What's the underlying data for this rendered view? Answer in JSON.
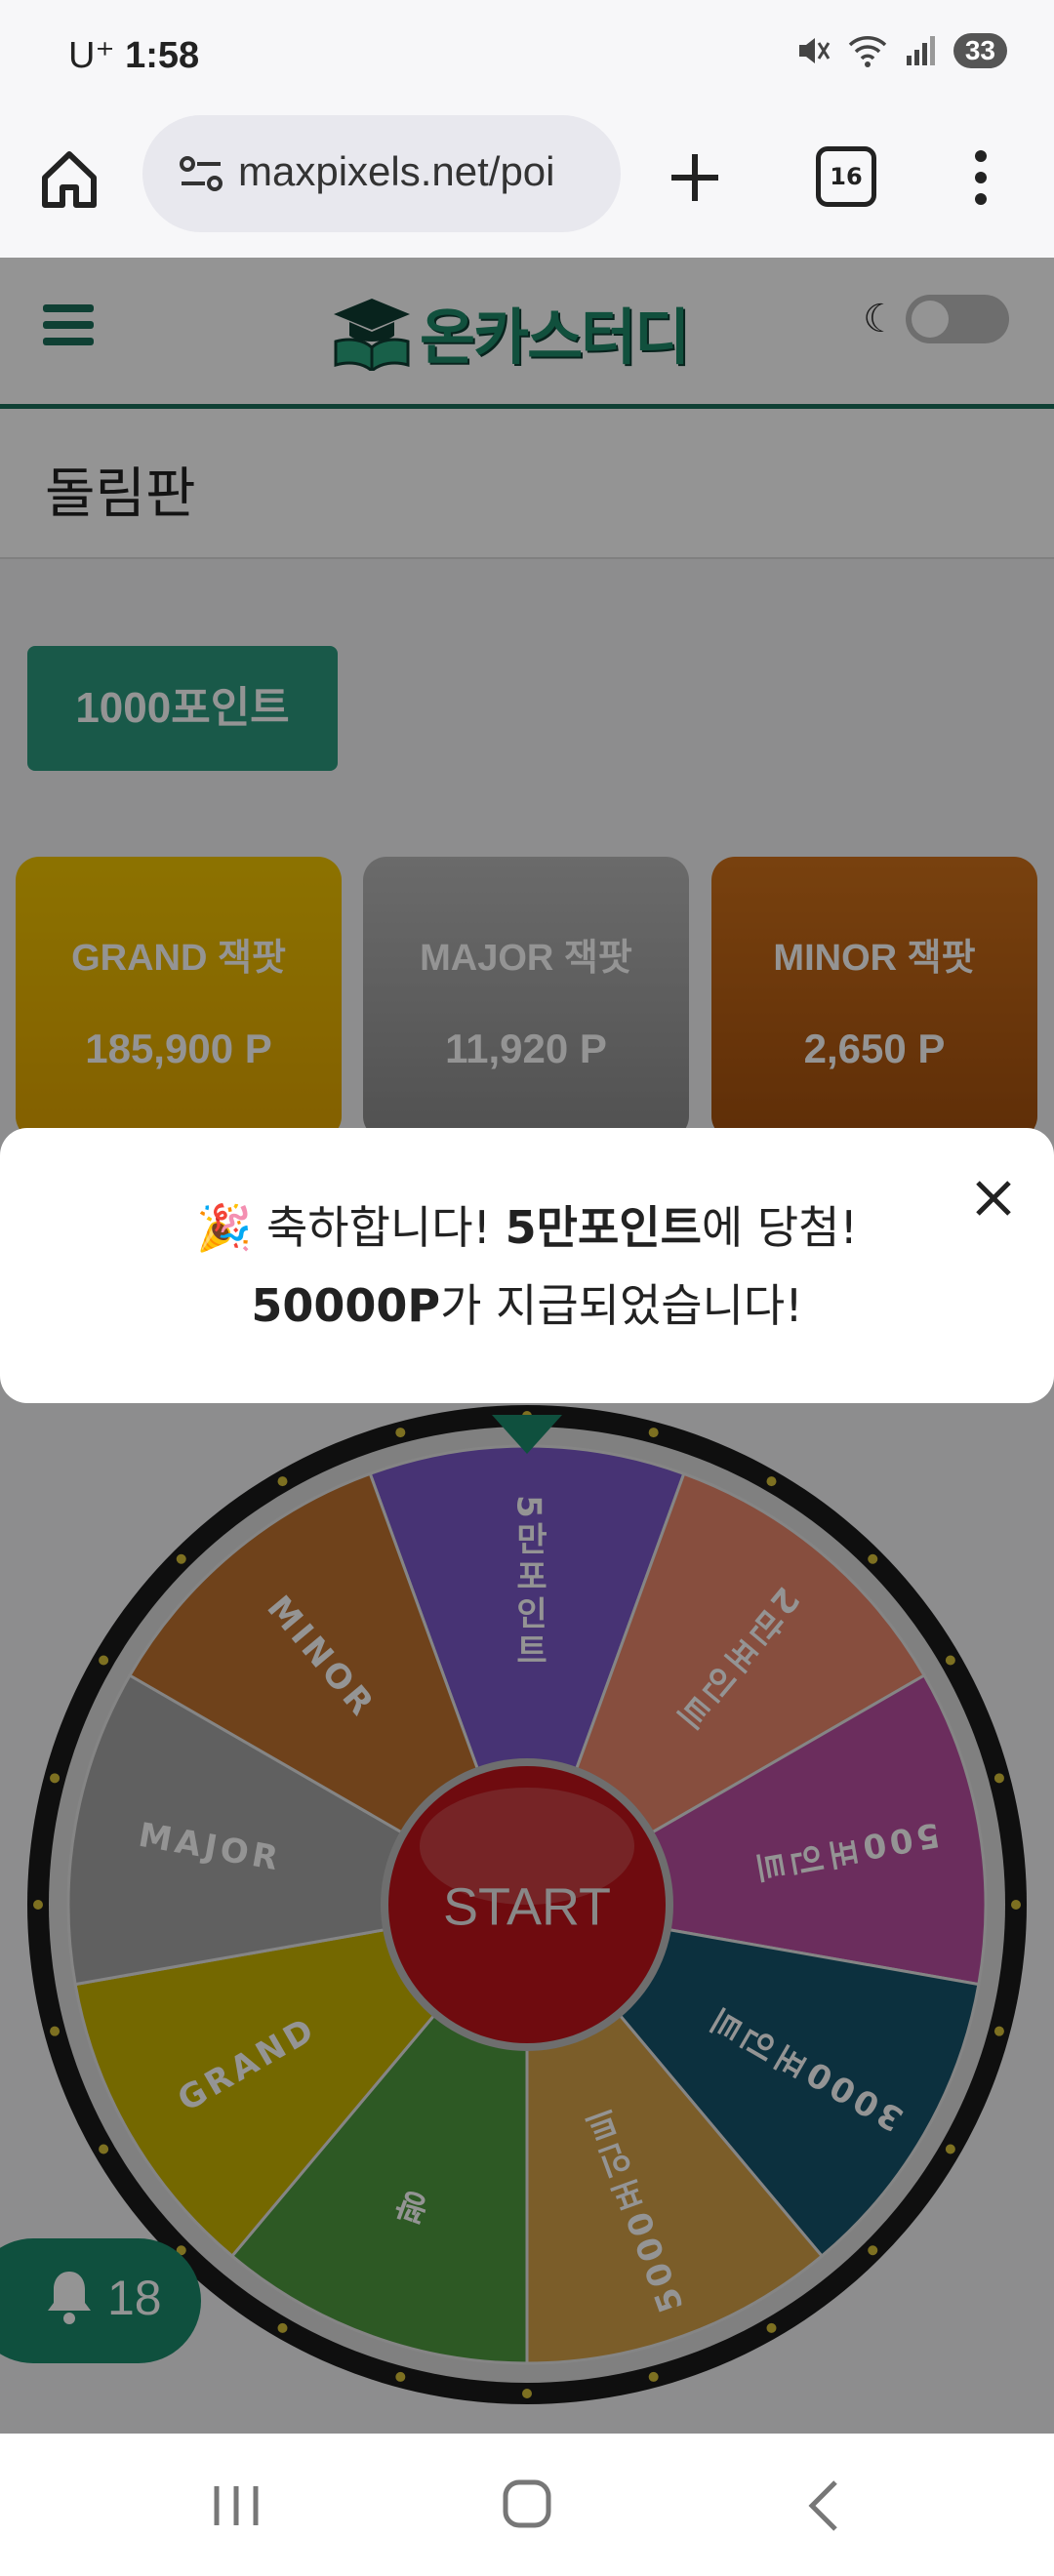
{
  "status_bar": {
    "carrier": "U⁺",
    "time": "1:58",
    "battery": "33"
  },
  "browser": {
    "url": "maxpixels.net/poi",
    "tab_count": "16"
  },
  "site": {
    "logo_text": "온카스터디",
    "page_title": "돌림판",
    "points_button": "1000포인트",
    "jackpots": [
      {
        "name": "GRAND 잭팟",
        "value": "185,900 P"
      },
      {
        "name": "MAJOR 잭팟",
        "value": "11,920 P"
      },
      {
        "name": "MINOR 잭팟",
        "value": "2,650 P"
      }
    ],
    "wheel": {
      "start_label": "START",
      "segments": [
        "5만포인트",
        "2만포인트",
        "500포인트",
        "3000포인트",
        "5000포인트",
        "꽝",
        "GRAND",
        "MAJOR",
        "MINOR"
      ],
      "segment_colors": [
        "#7a58c8",
        "#e8876b",
        "#b94fa1",
        "#16536b",
        "#d4a147",
        "#4f9a3f",
        "#c9b400",
        "#a6a6a6",
        "#bf7330"
      ]
    },
    "notification_count": "18"
  },
  "toast": {
    "emoji": "🎉",
    "line1_pre": "축하합니다! ",
    "line1_bold": "5만포인트",
    "line1_post": "에 당첨!",
    "line2_bold": "50000P",
    "line2_post": "가 지급되었습니다!"
  }
}
